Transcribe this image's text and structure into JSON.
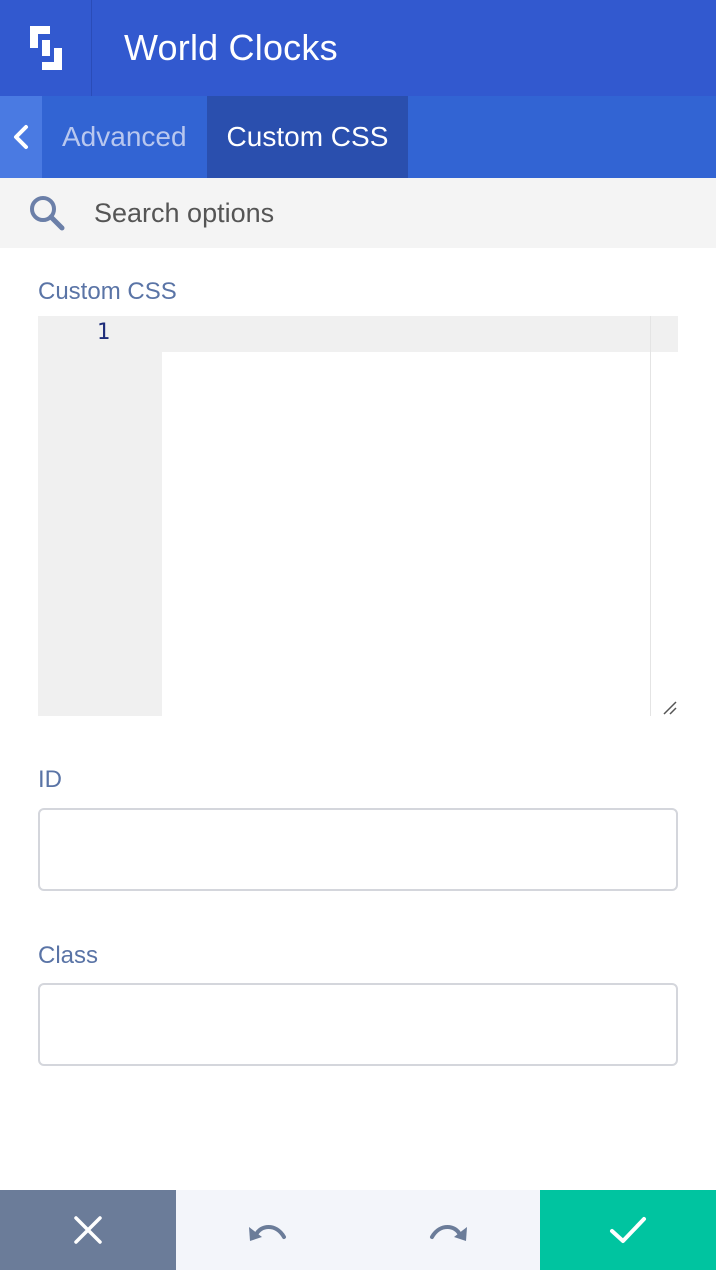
{
  "header": {
    "title": "World Clocks",
    "logo_icon": "builder-logo-icon"
  },
  "tabs": [
    {
      "label": "Advanced",
      "active": false
    },
    {
      "label": "Custom CSS",
      "active": true
    }
  ],
  "search": {
    "placeholder": "Search options",
    "value": ""
  },
  "fields": {
    "custom_css": {
      "label": "Custom CSS",
      "line_number": "1",
      "value": ""
    },
    "id": {
      "label": "ID",
      "value": ""
    },
    "class": {
      "label": "Class",
      "value": ""
    }
  },
  "footer": {
    "close_icon": "close-icon",
    "undo_icon": "undo-icon",
    "redo_icon": "redo-icon",
    "save_icon": "check-icon"
  },
  "colors": {
    "header_bg": "#3259cf",
    "tabs_bg": "#3264d3",
    "active_tab_bg": "#2a4fae",
    "label": "#5a74a6",
    "save": "#00c4a0",
    "close": "#6b7c99"
  }
}
